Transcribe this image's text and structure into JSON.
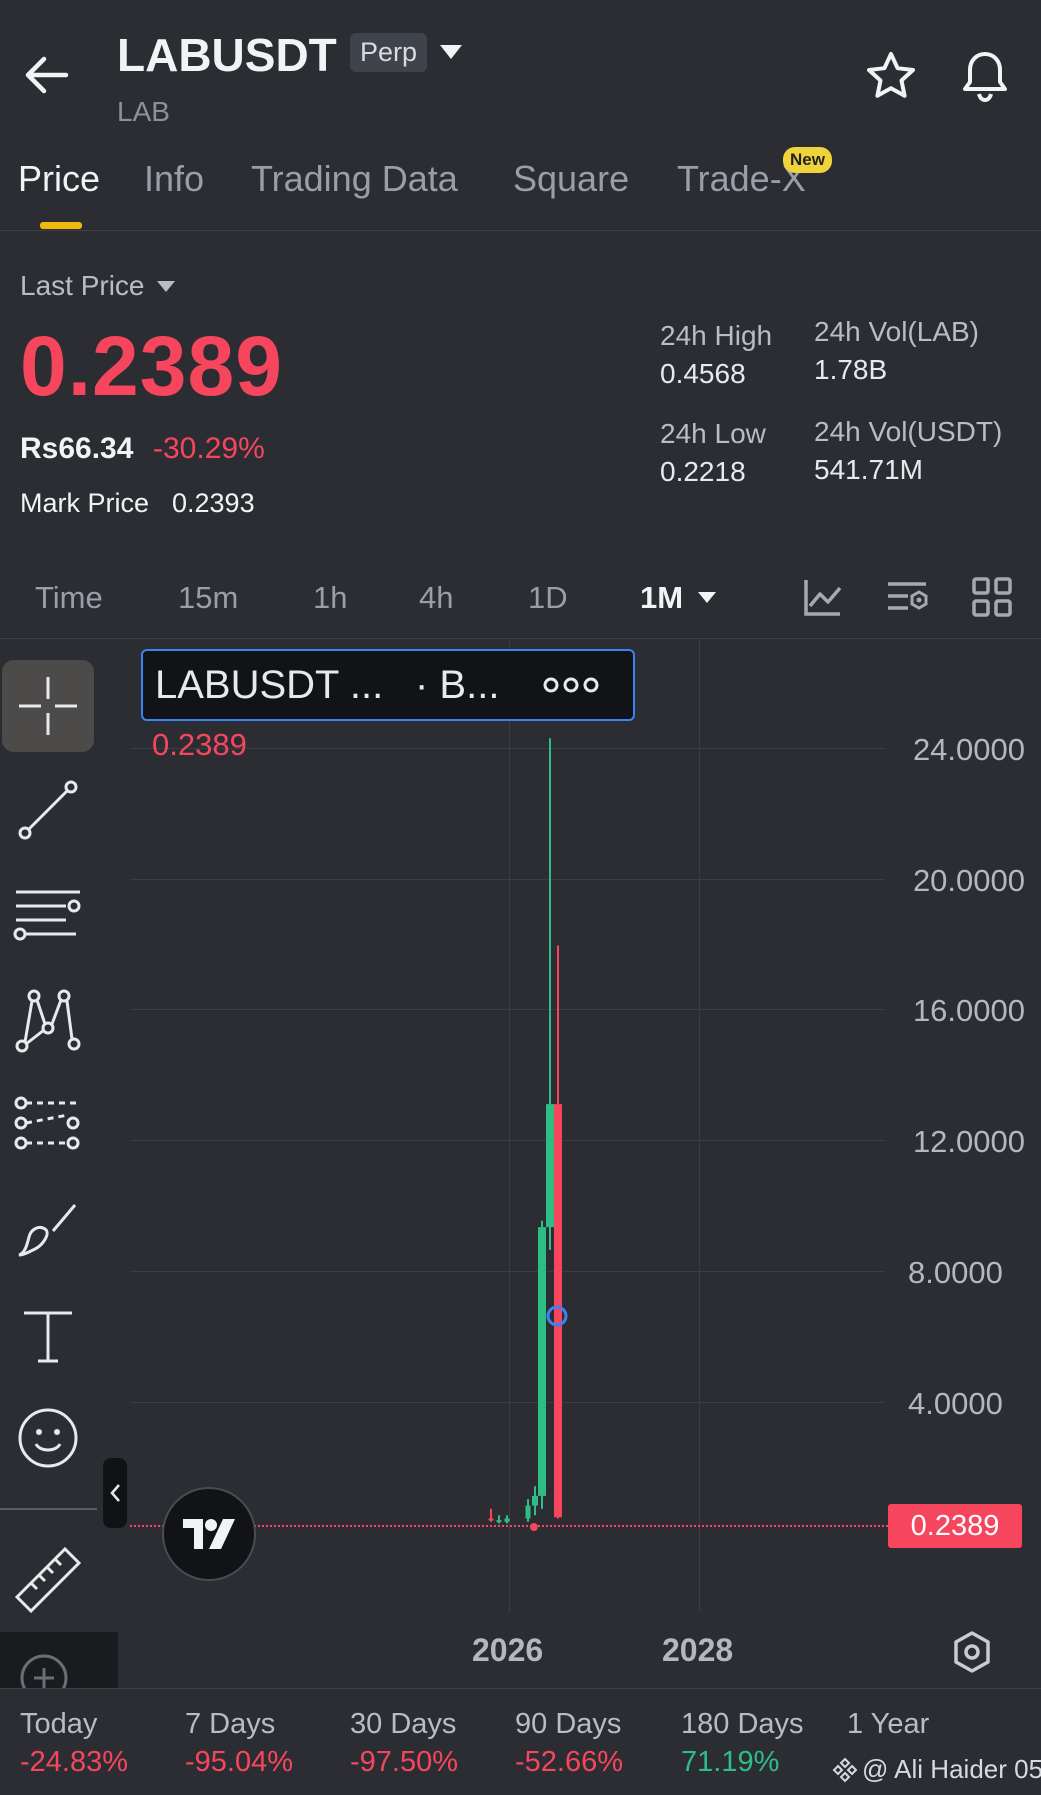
{
  "header": {
    "symbol": "LABUSDT",
    "badge": "Perp",
    "base": "LAB"
  },
  "tabs": [
    {
      "label": "Price"
    },
    {
      "label": "Info"
    },
    {
      "label": "Trading Data"
    },
    {
      "label": "Square"
    },
    {
      "label": "Trade-X"
    }
  ],
  "new_badge": "New",
  "price": {
    "label": "Last Price",
    "last": "0.2389",
    "local": "Rs66.34",
    "change": "-30.29%",
    "mark_label": "Mark Price",
    "mark": "0.2393"
  },
  "stats": {
    "high_label": "24h High",
    "high": "0.4568",
    "low_label": "24h Low",
    "low": "0.2218",
    "vol_base_label": "24h Vol(LAB)",
    "vol_base": "1.78B",
    "vol_quote_label": "24h Vol(USDT)",
    "vol_quote": "541.71M"
  },
  "timeframes": [
    "Time",
    "15m",
    "1h",
    "4h",
    "1D",
    "1M"
  ],
  "legend": {
    "title": "LABUSDT ...",
    "source": "· B...",
    "value": "0.2389"
  },
  "current_price_tag": "0.2389",
  "watermark": "@ Ali Haider 05",
  "performance": [
    {
      "label": "Today",
      "value": "-24.83%",
      "color": "#f6465d"
    },
    {
      "label": "7 Days",
      "value": "-95.04%",
      "color": "#f6465d"
    },
    {
      "label": "30 Days",
      "value": "-97.50%",
      "color": "#f6465d"
    },
    {
      "label": "90 Days",
      "value": "-52.66%",
      "color": "#f6465d"
    },
    {
      "label": "180 Days",
      "value": "71.19%",
      "color": "#2ebd85"
    },
    {
      "label": "1 Year",
      "value": "",
      "color": "#2ebd85"
    }
  ],
  "colors": {
    "up": "#2ebd85",
    "down": "#f6465d",
    "accent": "#f0b90b"
  },
  "chart_data": {
    "type": "candlestick",
    "y_ticks": [
      "24.0000",
      "20.0000",
      "16.0000",
      "12.0000",
      "8.0000",
      "4.0000"
    ],
    "x_ticks": [
      "2026",
      "2028"
    ],
    "ylim": [
      0,
      24
    ],
    "candles": [
      {
        "open": 0.2,
        "high": 0.5,
        "low": 0.1,
        "close": 0.15,
        "dir": "down"
      },
      {
        "open": 0.15,
        "high": 0.3,
        "low": 0.05,
        "close": 0.1,
        "dir": "up"
      },
      {
        "open": 0.1,
        "high": 0.3,
        "low": 0.05,
        "close": 0.2,
        "dir": "up"
      },
      {
        "open": 0.2,
        "high": 0.8,
        "low": 0.1,
        "close": 0.6,
        "dir": "up"
      },
      {
        "open": 0.6,
        "high": 1.2,
        "low": 0.3,
        "close": 0.9,
        "dir": "up"
      },
      {
        "open": 0.9,
        "high": 9.4,
        "low": 0.5,
        "close": 9.2,
        "dir": "up"
      },
      {
        "open": 9.2,
        "high": 24.3,
        "low": 8.5,
        "close": 13.0,
        "dir": "up"
      },
      {
        "open": 13.0,
        "high": 17.9,
        "low": 0.2,
        "close": 0.2389,
        "dir": "down"
      }
    ]
  }
}
